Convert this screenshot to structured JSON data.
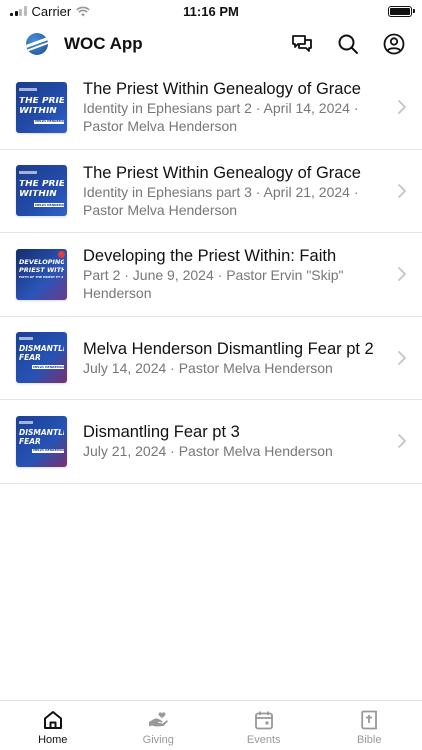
{
  "status_bar": {
    "carrier": "Carrier",
    "time": "11:16 PM"
  },
  "header": {
    "title": "WOC App",
    "icons": [
      "chat-icon",
      "search-icon",
      "profile-icon"
    ]
  },
  "sermons": [
    {
      "title": "The Priest Within Genealogy of Grace",
      "subtitle": "Identity in Ephesians part 2 · April 14, 2024 · Pastor Melva Henderson",
      "thumb_text": [
        "THE PRIEST",
        "WITHIN"
      ],
      "thumb_small": "MELVA HENDERSON"
    },
    {
      "title": "The Priest Within Genealogy of Grace",
      "subtitle": "Identity in Ephesians part 3 · April 21, 2024 · Pastor Melva Henderson",
      "thumb_text": [
        "THE PRIEST",
        "WITHIN"
      ],
      "thumb_small": "MELVA HENDERSON"
    },
    {
      "title": "Developing the Priest Within: Faith",
      "subtitle": "Part 2 · June 9, 2024 · Pastor Ervin \"Skip\" Henderson",
      "thumb_text": [
        "DEVELOPING THE",
        "PRIEST WITHIN"
      ],
      "thumb_small": "FAITH OF THE PRIEST PT 2"
    },
    {
      "title": "Melva Henderson Dismantling Fear pt 2",
      "subtitle": "July 14, 2024 · Pastor Melva Henderson",
      "thumb_text": [
        "DISMANTLING",
        "FEAR"
      ],
      "thumb_small": "MELVA HENDERSON"
    },
    {
      "title": "Dismantling Fear pt 3",
      "subtitle": "July 21, 2024 · Pastor Melva Henderson",
      "thumb_text": [
        "DISMANTLING",
        "FEAR"
      ],
      "thumb_small": "MELVA HENDERSON"
    }
  ],
  "tabs": [
    {
      "label": "Home",
      "icon": "home-icon",
      "active": true
    },
    {
      "label": "Giving",
      "icon": "giving-icon",
      "active": false
    },
    {
      "label": "Events",
      "icon": "calendar-icon",
      "active": false
    },
    {
      "label": "Bible",
      "icon": "bible-icon",
      "active": false
    }
  ]
}
